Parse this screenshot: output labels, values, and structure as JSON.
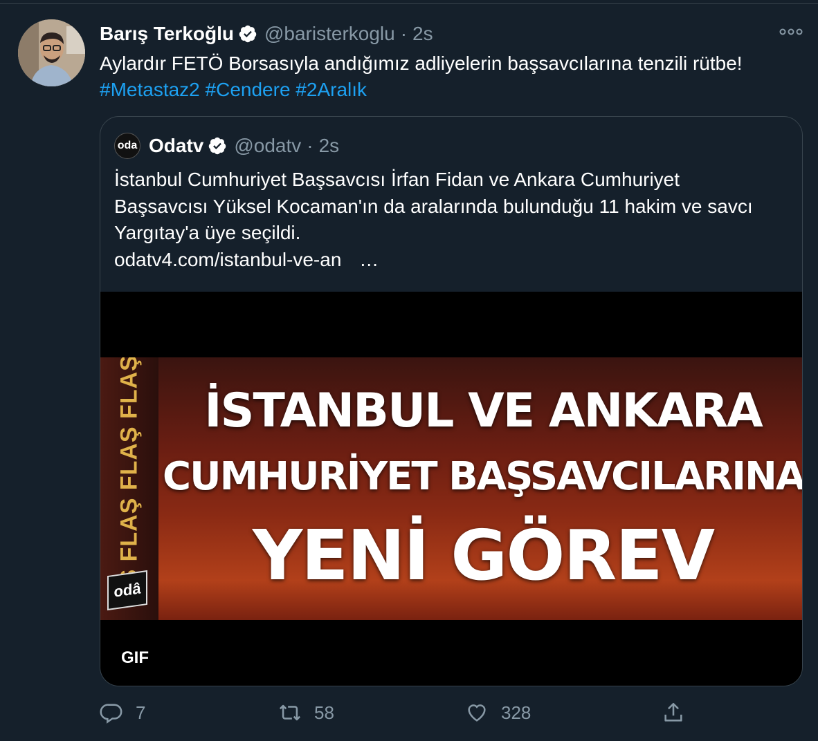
{
  "tweet": {
    "author_name": "Barış Terkoğlu",
    "handle": "@baristerkoglu",
    "separator": "·",
    "time": "2s",
    "text": "Aylardır FETÖ Borsasıyla andığımız adliyelerin başsavcılarına tenzili rütbe!",
    "hashtags": [
      "#Metastaz2",
      "#Cendere",
      "#2Aralık"
    ]
  },
  "quoted": {
    "author_name": "Odatv",
    "handle": "@odatv",
    "time": "2s",
    "avatar_text": "oda",
    "text": "İstanbul Cumhuriyet Başsavcısı İrfan Fidan ve Ankara Cumhuriyet Başsavcısı Yüksel Kocaman'ın da aralarında bulunduğu 11 hakim ve savcı Yargıtay'a üye seçildi.",
    "link": "odatv4.com/istanbul-ve-an",
    "link_ellipsis": "…",
    "media": {
      "line1": "İSTANBUL VE ANKARA",
      "line2": "CUMHURİYET BAŞSAVCILARINA",
      "line3": "YENİ GÖREV",
      "side_text": "Ş FLAŞ FLAŞ FLAŞ",
      "logo_text": "odâ",
      "badge": "GIF"
    }
  },
  "actions": {
    "replies": "7",
    "retweets": "58",
    "likes": "328"
  },
  "colors": {
    "background": "#15202b",
    "secondary_text": "#8899a6",
    "link": "#1da1f2",
    "border": "#38444d"
  }
}
